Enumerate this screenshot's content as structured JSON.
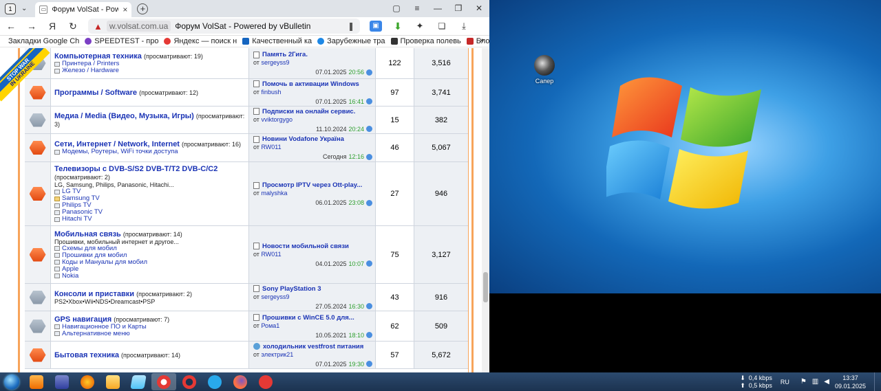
{
  "browser": {
    "tab_count": "1",
    "tab_title": "Форум VolSat - Powered",
    "url_host": "w.volsat.com.ua",
    "page_title": "Форум VolSat - Powered by vBulletin",
    "bookmarks": [
      {
        "label": "Закладки Google Ch",
        "color": "#e0a020"
      },
      {
        "label": "SPEEDTEST - про",
        "color": "#7b3fc4"
      },
      {
        "label": "Яндекс — поиск н",
        "color": "#e53935"
      },
      {
        "label": "Качественный ка",
        "color": "#1565c0"
      },
      {
        "label": "Зарубежные тра",
        "color": "#1e88e5"
      },
      {
        "label": "Проверка полевь",
        "color": "#333333"
      },
      {
        "label": "Блоки питан",
        "color": "#c62828"
      }
    ],
    "bookmarks_more": "»"
  },
  "ribbon": {
    "line1": "STOP WAR",
    "line2": "IN UKRAINE"
  },
  "forums": [
    {
      "name": "Компьютерная техника",
      "viewing": "(просматривают: 19)",
      "desc": "",
      "subs": [
        {
          "label": "Принтера / Printers",
          "folder": false
        },
        {
          "label": "Железо / Hardware",
          "folder": false
        }
      ],
      "status": "old",
      "last_title": "Память 2Гига.",
      "last_by_prefix": "от",
      "last_by": "sergeyss9",
      "last_date": "07.01.2025",
      "last_time": "20:56",
      "threads": "122",
      "posts": "3,516"
    },
    {
      "name": "Программы / Software",
      "viewing": "(просматривают: 12)",
      "desc": "",
      "subs": [],
      "status": "new",
      "last_title": "Помочь в активации Windows",
      "last_by_prefix": "от",
      "last_by": "finbush",
      "last_date": "07.01.2025",
      "last_time": "16:41",
      "threads": "97",
      "posts": "3,741"
    },
    {
      "name": "Медиа / Media (Видео, Музыка, Игры)",
      "viewing": "(просматривают: 3)",
      "desc": "",
      "subs": [],
      "status": "old",
      "last_title": "Подписки на онлайн сервис.",
      "last_by_prefix": "от",
      "last_by": "vviktorgygo",
      "last_date": "11.10.2024",
      "last_time": "20:24",
      "threads": "15",
      "posts": "382"
    },
    {
      "name": "Сети, Интернет / Network, Internet",
      "viewing": "(просматривают: 16)",
      "desc": "",
      "subs": [
        {
          "label": "Модемы, Роутеры, WiFi точки доступа",
          "folder": false
        }
      ],
      "status": "new",
      "last_title": "Новини Vodafone Україна",
      "last_by_prefix": "от",
      "last_by": "RW011",
      "last_date": "Сегодня",
      "last_time": "12:16",
      "threads": "46",
      "posts": "5,067"
    },
    {
      "name": "Телевизоры с DVB-S/S2 DVB-T/T2 DVB-C/C2",
      "viewing": "(просматривают: 2)",
      "desc": "LG, Samsung, Philips, Panasonic, Hitachi...",
      "subs": [
        {
          "label": "LG TV",
          "folder": false
        },
        {
          "label": "Samsung TV",
          "folder": true
        },
        {
          "label": "Philips TV",
          "folder": false
        },
        {
          "label": "Panasonic TV",
          "folder": false
        },
        {
          "label": "Hitachi TV",
          "folder": false
        }
      ],
      "status": "new",
      "last_title": "Просмотр IPTV через Ott-play...",
      "last_by_prefix": "от",
      "last_by": "malyshka",
      "last_date": "06.01.2025",
      "last_time": "23:08",
      "threads": "27",
      "posts": "946"
    },
    {
      "name": "Мобильная связь",
      "viewing": "(просматривают: 14)",
      "desc": "Прошивки, мобильный интернет и другое...",
      "subs": [
        {
          "label": "Схемы для мобил",
          "folder": false
        },
        {
          "label": "Прошивки для мобил",
          "folder": false
        },
        {
          "label": "Коды и Мануалы для мобил",
          "folder": false
        },
        {
          "label": "Apple",
          "folder": false
        },
        {
          "label": "Nokia",
          "folder": false
        }
      ],
      "status": "new",
      "last_title": "Новости мобильной связи",
      "last_by_prefix": "от",
      "last_by": "RW011",
      "last_date": "04.01.2025",
      "last_time": "10:07",
      "threads": "75",
      "posts": "3,127"
    },
    {
      "name": "Консоли и приставки",
      "viewing": "(просматривают: 2)",
      "desc": "PS2•Xbox•Wii•NDS•Dreamcast•PSP",
      "subs": [],
      "status": "old",
      "last_title": "Sony PlayStation 3",
      "last_by_prefix": "от",
      "last_by": "sergeyss9",
      "last_date": "27.05.2024",
      "last_time": "16:30",
      "threads": "43",
      "posts": "916"
    },
    {
      "name": "GPS навигация",
      "viewing": "(просматривают: 7)",
      "desc": "",
      "subs": [
        {
          "label": "Навигационное ПО и Карты",
          "folder": false
        },
        {
          "label": "Альтернативное меню",
          "folder": false
        }
      ],
      "status": "old",
      "last_title": "Прошивки с WinCE 5.0 для...",
      "last_by_prefix": "от",
      "last_by": "Рома1",
      "last_date": "10.05.2021",
      "last_time": "18:10",
      "threads": "62",
      "posts": "509"
    },
    {
      "name": "Бытовая техника",
      "viewing": "(просматривают: 14)",
      "desc": "",
      "subs": [],
      "status": "new",
      "smile": true,
      "last_title": "холодильник vestfrost питания",
      "last_by_prefix": "от",
      "last_by": "электрик21",
      "last_date": "07.01.2025",
      "last_time": "19:30",
      "threads": "57",
      "posts": "5,672"
    }
  ],
  "desktop": {
    "icon_label": "Сапер"
  },
  "taskbar": {
    "net_down": "0,4 kbps",
    "net_up": "0,5 kbps",
    "lang": "RU",
    "time": "13:37",
    "date": "09.01.2025"
  }
}
